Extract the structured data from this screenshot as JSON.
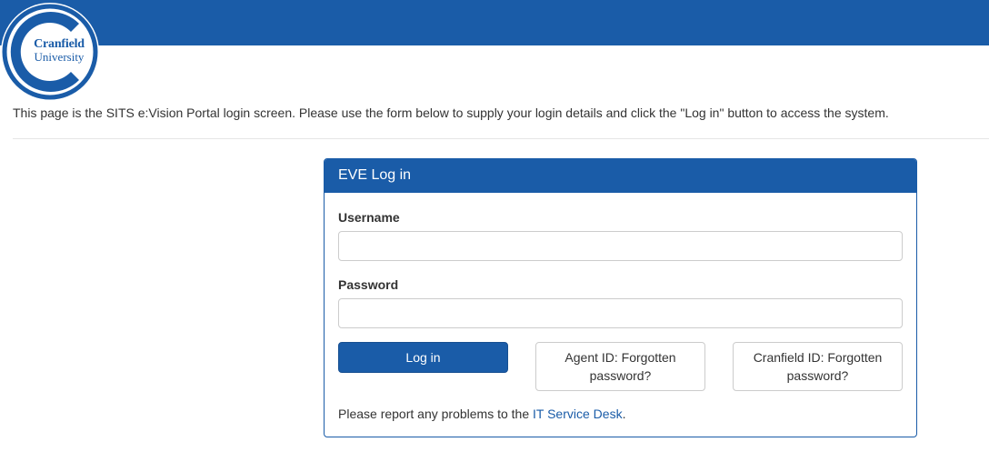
{
  "header": {
    "logo": {
      "line1": "Cranfield",
      "line2": "University",
      "icon": "cranfield-c-logo",
      "color": "#1a5ca8"
    },
    "bar_color": "#1a5ca8"
  },
  "intro_text": "This page is the SITS e:Vision Portal login screen. Please use the form below to supply your login details and click the \"Log in\" button to access the system.",
  "panel": {
    "title": "EVE Log in",
    "username": {
      "label": "Username",
      "value": "",
      "placeholder": ""
    },
    "password": {
      "label": "Password",
      "value": "",
      "placeholder": ""
    },
    "login_button": "Log in",
    "agent_forgot_button": "Agent ID: Forgotten password?",
    "cranfield_forgot_button": "Cranfield ID: Forgotten password?",
    "report": {
      "prefix": "Please report any problems to the ",
      "link_text": "IT Service Desk",
      "suffix": "."
    }
  }
}
